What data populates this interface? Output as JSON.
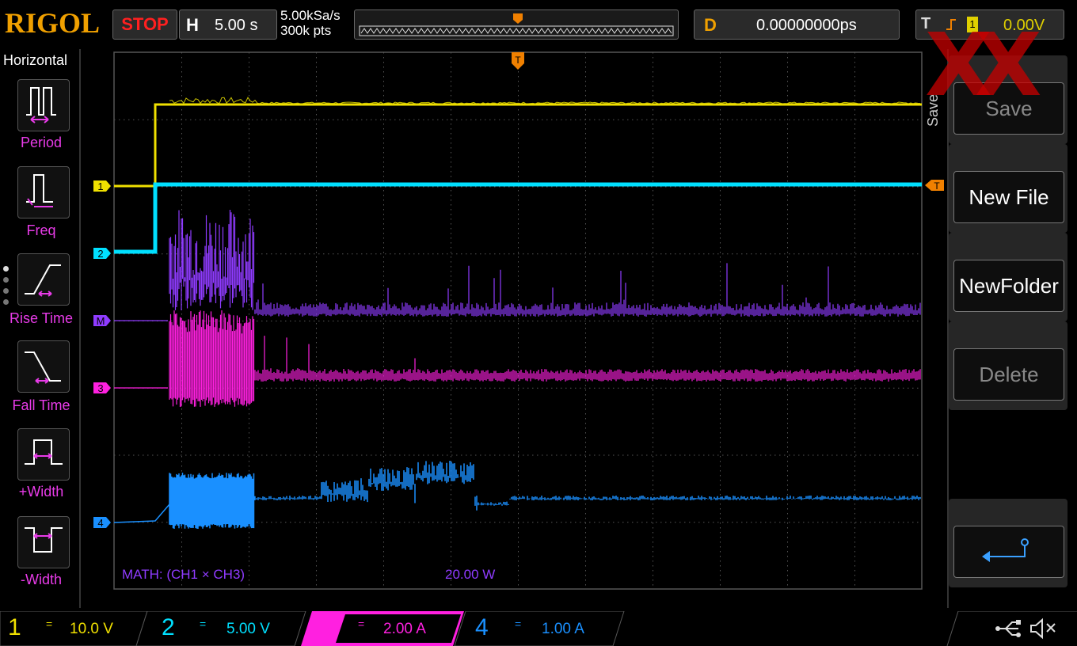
{
  "header": {
    "brand": "RIGOL",
    "run_state": "STOP",
    "horizontal_label": "H",
    "timebase": "5.00 s",
    "sample_rate": "5.00kSa/s",
    "memory_depth": "300k pts",
    "delay_label": "D",
    "delay_value": "0.00000000ps",
    "trigger_label": "T",
    "trigger_channel": "1",
    "trigger_level": "0.00V"
  },
  "left_menu": {
    "title": "Horizontal",
    "items": [
      {
        "label": "Period",
        "icon": "period-icon"
      },
      {
        "label": "Freq",
        "icon": "frequency-icon"
      },
      {
        "label": "Rise Time",
        "icon": "rise-time-icon"
      },
      {
        "label": "Fall Time",
        "icon": "fall-time-icon"
      },
      {
        "label": "+Width",
        "icon": "positive-width-icon"
      },
      {
        "label": "-Width",
        "icon": "negative-width-icon"
      }
    ]
  },
  "right_menu": {
    "title": "Save",
    "buttons": [
      "Save",
      "New File",
      "NewFolder",
      "Delete"
    ],
    "back_icon": "return-arrow-icon"
  },
  "markers": {
    "ch1": "1",
    "ch2": "2",
    "math": "M",
    "ch3": "3",
    "ch4": "4",
    "trigger": "T"
  },
  "math": {
    "expression": "MATH:  (CH1 × CH3)",
    "scale": "20.00 W"
  },
  "channels": [
    {
      "number": "1",
      "coupling": "=",
      "scale": "10.0 V",
      "color": "#f0e000"
    },
    {
      "number": "2",
      "coupling": "=",
      "scale": "5.00 V",
      "color": "#00e0ff"
    },
    {
      "number": "3",
      "coupling": "=",
      "scale": "2.00 A",
      "color": "#ff20e0"
    },
    {
      "number": "4",
      "coupling": "=",
      "scale": "1.00 A",
      "color": "#1a90ff"
    }
  ],
  "status_icons": [
    "usb-icon",
    "speaker-muted-icon"
  ],
  "watermark": "XX",
  "colors": {
    "ch1": "#f0e000",
    "ch2": "#00e0ff",
    "ch3": "#ff20e0",
    "ch4": "#1a90ff",
    "math": "#8f3bff",
    "trigger": "#f08000"
  }
}
